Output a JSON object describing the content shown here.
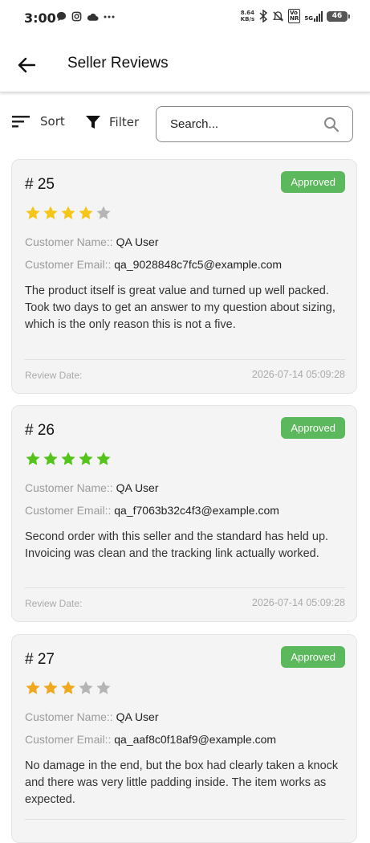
{
  "status_bar": {
    "time": "3:00",
    "net_speed_value": "8.64",
    "net_speed_unit": "KB/s",
    "volte": "Vo",
    "volte2": "NR",
    "signal_label": "5G",
    "battery": "46"
  },
  "header": {
    "title": "Seller Reviews"
  },
  "toolbar": {
    "sort_label": "Sort",
    "filter_label": "Filter",
    "search_placeholder": "Search..."
  },
  "labels": {
    "customer_name": "Customer Name::",
    "customer_email": "Customer Email::",
    "review_date": "Review Date:"
  },
  "colors": {
    "approved": "#5cb85c",
    "star_gold": "#f5c518",
    "star_green": "#52c41a",
    "star_orange": "#f0a81c",
    "star_empty": "#b5b5b5"
  },
  "reviews": [
    {
      "number": "# 25",
      "status": "Approved",
      "rating": 4,
      "star_color": "#f5c518",
      "customer_name": "QA User",
      "customer_email": "qa_9028848c7fc5@example.com",
      "text": "The product itself is great value and turned up well packed. Took two days to get an answer to my question about sizing, which is the only reason this is not a five.",
      "date": "2026-07-14 05:09:28"
    },
    {
      "number": "# 26",
      "status": "Approved",
      "rating": 5,
      "star_color": "#52c41a",
      "customer_name": "QA User",
      "customer_email": "qa_f7063b32c4f3@example.com",
      "text": "Second order with this seller and the standard has held up. Invoicing was clean and the tracking link actually worked.",
      "date": "2026-07-14 05:09:28"
    },
    {
      "number": "# 27",
      "status": "Approved",
      "rating": 3,
      "star_color": "#f0a81c",
      "customer_name": "QA User",
      "customer_email": "qa_aaf8c0f18af9@example.com",
      "text": "No damage in the end, but the box had clearly taken a knock and there was very little padding inside. The item works as expected.",
      "date": ""
    }
  ]
}
